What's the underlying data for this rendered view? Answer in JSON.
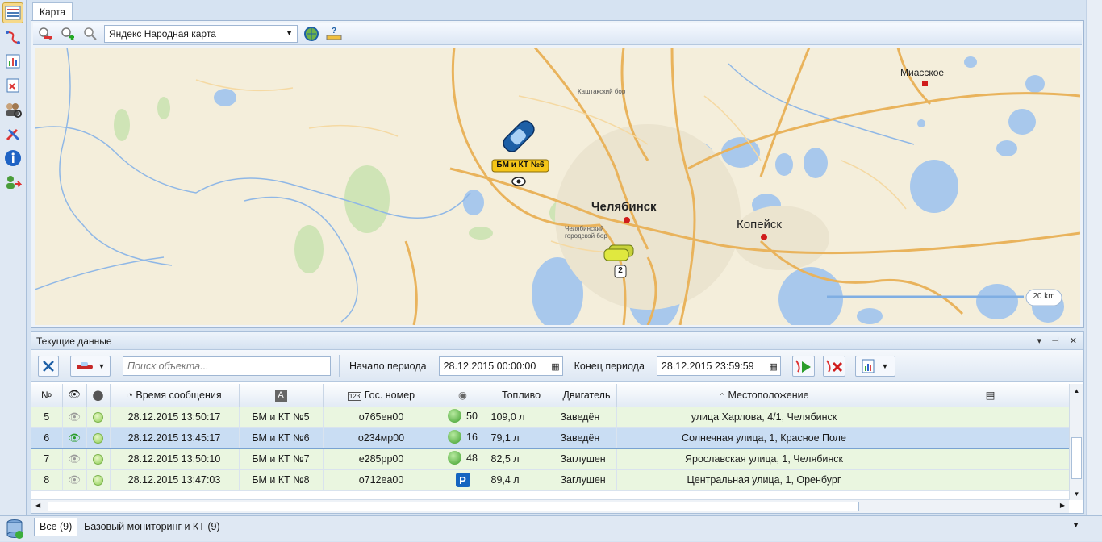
{
  "map_panel": {
    "tab_label": "Карта",
    "map_provider": "Яндекс Народная карта",
    "labels": {
      "city_main": "Челябинск",
      "city_east": "Копейск",
      "village_ne": "Миасское",
      "forest_n": "Каштакский бор",
      "forest_c": "Челябинский\nгородской бор",
      "vehicle_label": "БМ и КТ №6",
      "cluster_count": "2",
      "scale": "20 km"
    }
  },
  "data_panel": {
    "title": "Текущие данные",
    "search_placeholder": "Поиск объекта...",
    "period_start_label": "Начало периода",
    "period_start_value": "28.12.2015 00:00:00",
    "period_end_label": "Конец периода",
    "period_end_value": "28.12.2015 23:59:59",
    "columns": [
      "№",
      "",
      "",
      "Время сообщения",
      "",
      "Гос. номер",
      "",
      "Топливо",
      "Двигатель",
      "Местоположение",
      ""
    ],
    "rows": [
      {
        "num": "5",
        "time": "28.12.2015 13:50:17",
        "name": "БМ и КТ №5",
        "plate": "о765ен00",
        "speed_icon": "moving-icon",
        "speed": "50",
        "fuel": "109,0 л",
        "engine": "Заведён",
        "location": "улица Харлова, 4/1, Челябинск",
        "selected": false
      },
      {
        "num": "6",
        "time": "28.12.2015 13:45:17",
        "name": "БМ и КТ №6",
        "plate": "о234мр00",
        "speed_icon": "moving-icon",
        "speed": "16",
        "fuel": "79,1 л",
        "engine": "Заведён",
        "location": "Солнечная улица, 1, Красное Поле",
        "selected": true
      },
      {
        "num": "7",
        "time": "28.12.2015 13:50:10",
        "name": "БМ и КТ №7",
        "plate": "е285рр00",
        "speed_icon": "moving-icon",
        "speed": "48",
        "fuel": "82,5 л",
        "engine": "Заглушен",
        "location": "Ярославская улица, 1, Челябинск",
        "selected": false
      },
      {
        "num": "8",
        "time": "28.12.2015 13:47:03",
        "name": "БМ и КТ №8",
        "plate": "о712еа00",
        "speed_icon": "parking-icon",
        "speed": "",
        "fuel": "89,4 л",
        "engine": "Заглушен",
        "location": "Центральная улица, 1, Оренбург",
        "selected": false
      }
    ]
  },
  "bottom_tabs": [
    {
      "label": "Все (9)",
      "active": true
    },
    {
      "label": "Базовый мониторинг и КТ (9)",
      "active": false
    }
  ],
  "colors": {
    "selected_row": "#c9ddf3",
    "row_bg": "#eaf6e0",
    "map_water": "#a8c8ec",
    "map_land": "#f4eedb",
    "map_road": "#f2c46a"
  }
}
